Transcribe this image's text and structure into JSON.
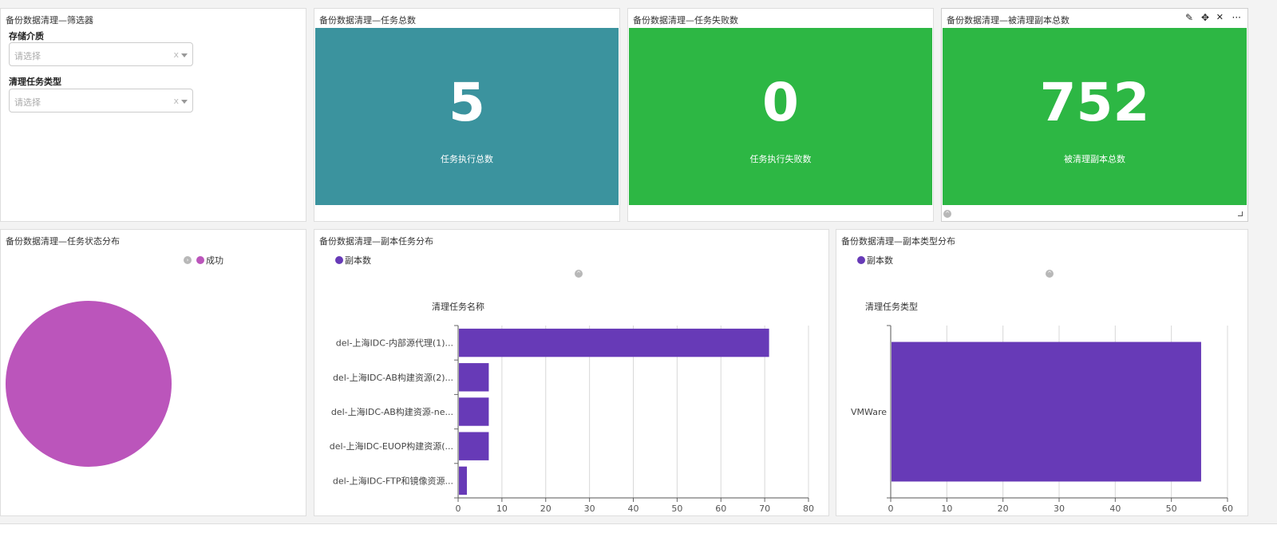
{
  "filter_panel": {
    "title": "备份数据清理—筛选器",
    "storage": {
      "label": "存储介质",
      "placeholder": "请选择",
      "clear": "x"
    },
    "task_type": {
      "label": "清理任务类型",
      "placeholder": "请选择",
      "clear": "x"
    }
  },
  "kpis": [
    {
      "title": "备份数据清理—任务总数",
      "value": "5",
      "caption": "任务执行总数",
      "color": "#3b939e"
    },
    {
      "title": "备份数据清理—任务失败数",
      "value": "0",
      "caption": "任务执行失败数",
      "color": "#2db744"
    },
    {
      "title": "备份数据清理—被清理副本总数",
      "value": "752",
      "caption": "被清理副本总数",
      "color": "#2db744"
    }
  ],
  "toolbar": {
    "edit_icon": "pencil-icon",
    "move_icon": "move-icon",
    "close_icon": "close-icon",
    "more_icon": "more-icon",
    "more_label": "···",
    "close_label": "✕",
    "move_label": "✥",
    "edit_label": "✎"
  },
  "pie_panel": {
    "title": "备份数据清理—任务状态分布",
    "legend": "成功",
    "color": "#bb55bb"
  },
  "bar_panel": {
    "title": "备份数据清理—副本任务分布",
    "legend": "副本数",
    "color": "#673ab7"
  },
  "type_panel": {
    "title": "备份数据清理—副本类型分布",
    "legend": "副本数",
    "color": "#673ab7"
  },
  "chart_data": [
    {
      "type": "pie",
      "categories": [
        "成功"
      ],
      "values": [
        5
      ],
      "legend": "top-right"
    },
    {
      "type": "bar",
      "orientation": "horizontal",
      "ylabel": "清理任务名称",
      "categories": [
        "del-上海IDC-内部源代理(1)...",
        "del-上海IDC-AB构建资源(2)...",
        "del-上海IDC-AB构建资源-ne...",
        "del-上海IDC-EUOP构建资源(...",
        "del-上海IDC-FTP和镜像资源..."
      ],
      "series": [
        {
          "name": "副本数",
          "values": [
            71,
            7,
            7,
            7,
            2
          ]
        }
      ],
      "xlim": [
        0,
        80
      ],
      "xticks": [
        "0",
        "10",
        "20",
        "30",
        "40",
        "50",
        "60",
        "70",
        "80"
      ],
      "grid": true,
      "legend": "top-left"
    },
    {
      "type": "bar",
      "orientation": "horizontal",
      "ylabel": "清理任务类型",
      "categories": [
        "VMWare"
      ],
      "series": [
        {
          "name": "副本数",
          "values": [
            55.3
          ]
        }
      ],
      "xlim": [
        0,
        60
      ],
      "xticks": [
        "0",
        "10",
        "20",
        "30",
        "40",
        "50",
        "60"
      ],
      "grid": true,
      "legend": "top-left"
    }
  ]
}
